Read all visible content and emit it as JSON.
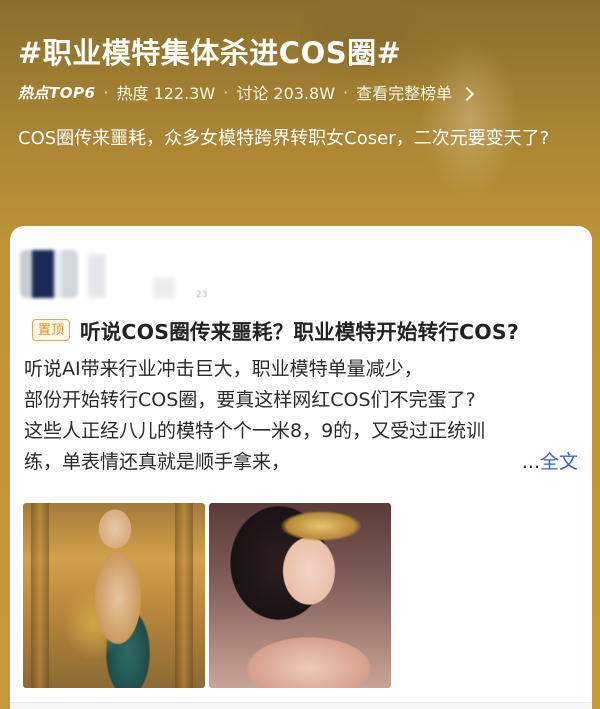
{
  "topic": {
    "title": "#职业模特集体杀进COS圈#",
    "hot_rank": "热点TOP6",
    "heat": "热度 122.3W",
    "discussion": "讨论 203.8W",
    "leaderboard_link": "查看完整榜单",
    "summary": "COS圈传来噩耗，众多女模特跨界转职女Coser，二次元要变天了?"
  },
  "post": {
    "author_name": "",
    "time": "23",
    "pinned_label": "置顶",
    "title": "听说COS圈传来噩耗？职业模特开始转行COS?",
    "body_lines": [
      "听说AI带来行业冲击巨大，职业模特单量减少，",
      "部份开始转行COS圈，要真这样网红COS们不完蛋了?",
      "这些人正经八儿的模特个个一米8，9的，又受过正统训",
      "练，单表情还真就是顺手拿来，"
    ],
    "ellipsis": "...",
    "full_text_link": "全文",
    "images": [
      {
        "name": "cosplay-photo-dancer",
        "watermark": ""
      },
      {
        "name": "cosplay-photo-portrait",
        "watermark": ""
      }
    ]
  },
  "colors": {
    "header_bg": "#bd9336",
    "pinned_accent": "#e38b1e",
    "link": "#2f6bb8",
    "hot_dot": "#ff7b3a"
  }
}
